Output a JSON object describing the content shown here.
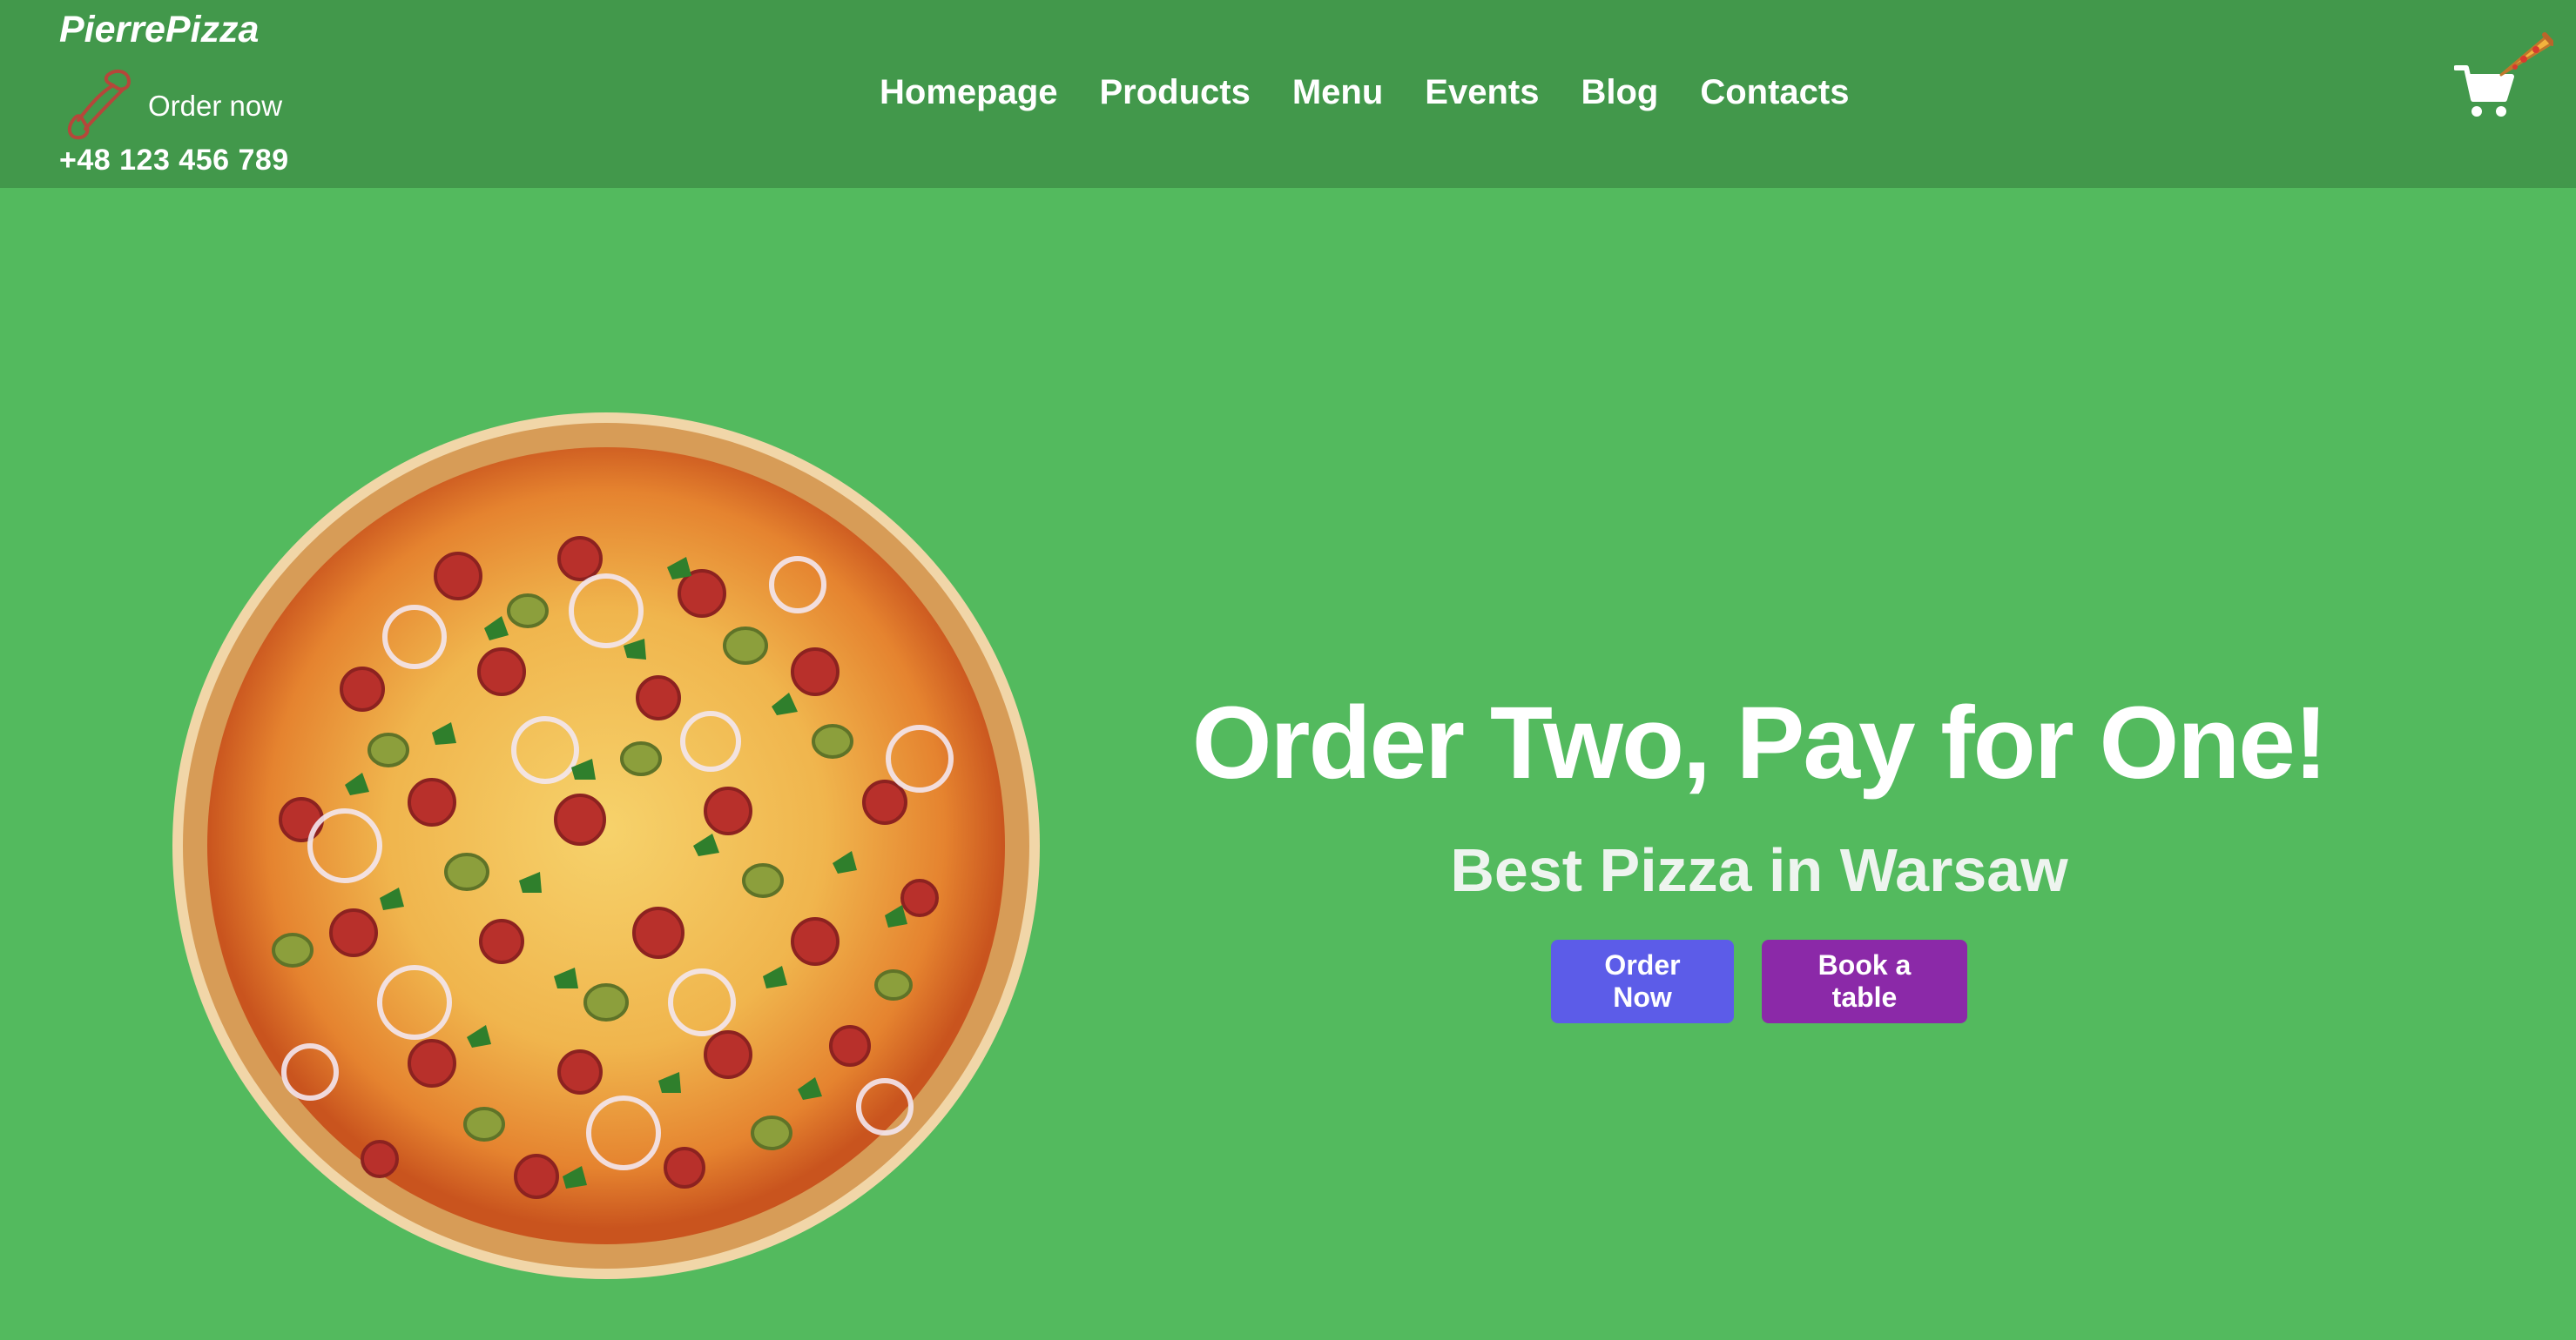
{
  "brand": {
    "name": "PierrePizza"
  },
  "contact": {
    "order_label": "Order now",
    "phone": "+48 123 456 789",
    "icon": "phone-icon"
  },
  "nav": {
    "items": [
      {
        "label": "Homepage"
      },
      {
        "label": "Products"
      },
      {
        "label": "Menu"
      },
      {
        "label": "Events"
      },
      {
        "label": "Blog"
      },
      {
        "label": "Contacts"
      }
    ]
  },
  "cart": {
    "icon": "cart-icon",
    "badge_icon": "pizza-slice-icon"
  },
  "hero": {
    "title": "Order Two, Pay for One!",
    "subtitle": "Best Pizza in Warsaw",
    "image": "pizza-image",
    "buttons": {
      "order_now": "Order Now",
      "book_table": "Book a table"
    }
  },
  "colors": {
    "page_background": "#53ba5e",
    "navbar_background": "#42984b",
    "order_button": "#5c5ce8",
    "book_button": "#8b29a8",
    "phone_icon": "#b5473a"
  }
}
